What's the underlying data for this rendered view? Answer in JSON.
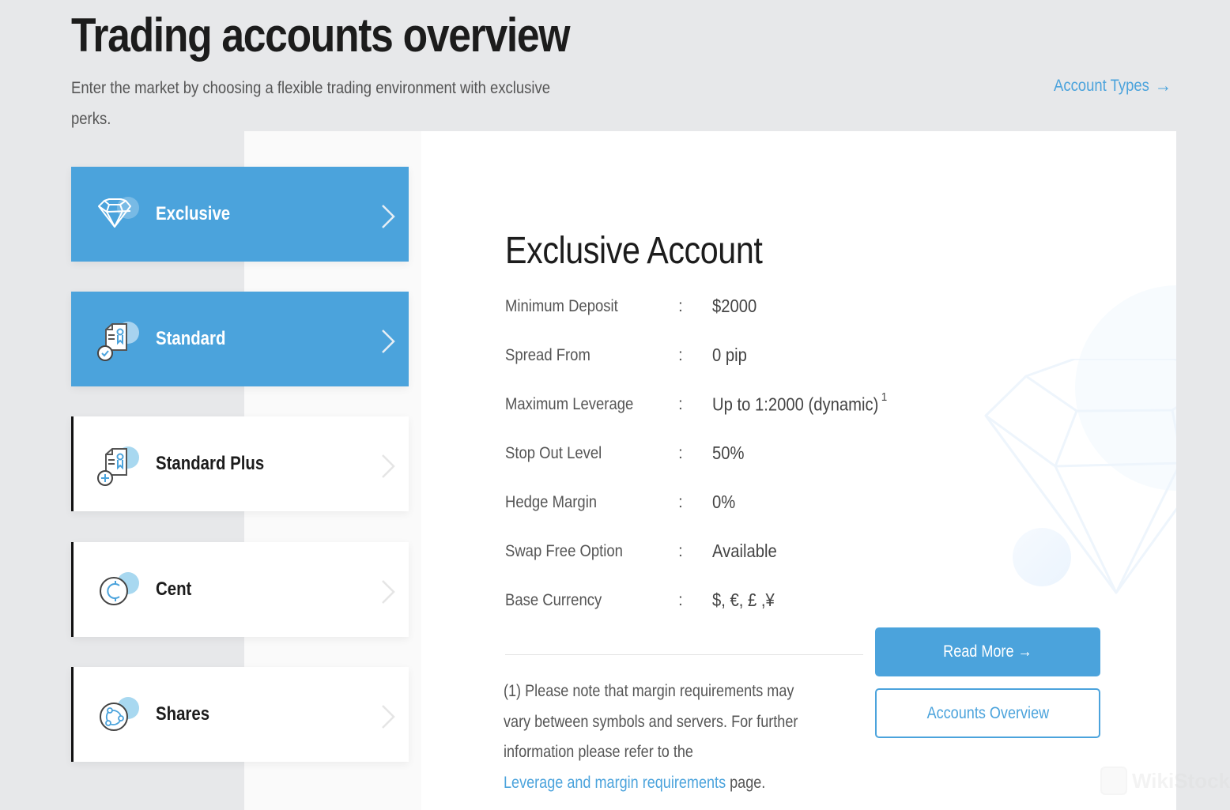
{
  "header": {
    "title": "Trading accounts overview",
    "subtitle": "Enter the market by choosing a flexible trading environment with exclusive perks.",
    "account_types_link": "Account Types",
    "account_types_arrow": "→"
  },
  "tabs": [
    {
      "label": "Exclusive",
      "icon": "diamond-icon",
      "active": true
    },
    {
      "label": "Standard",
      "icon": "certificate-check-icon",
      "active": true
    },
    {
      "label": "Standard Plus",
      "icon": "certificate-plus-icon",
      "active": false
    },
    {
      "label": "Cent",
      "icon": "cent-coin-icon",
      "active": false
    },
    {
      "label": "Shares",
      "icon": "shares-network-icon",
      "active": false
    }
  ],
  "account": {
    "title": "Exclusive Account",
    "specs": [
      {
        "label": "Minimum Deposit",
        "value": " $2000"
      },
      {
        "label": "Spread From",
        "value": "0 pip"
      },
      {
        "label": "Maximum Leverage",
        "value": "Up to 1:2000 (dynamic)",
        "footnote_ref": "1"
      },
      {
        "label": "Stop Out Level",
        "value": "50%"
      },
      {
        "label": "Hedge Margin",
        "value": "0%"
      },
      {
        "label": "Swap Free Option",
        "value": "Available"
      },
      {
        "label": "Base Currency",
        "value": "$, €, £ ,¥"
      }
    ],
    "separator": ":",
    "footnote_text": "(1) Please note that margin requirements may vary between symbols and servers. For further information please refer to the",
    "footnote_link": "Leverage and margin requirements",
    "footnote_tail": " page.",
    "read_more_label": "Read More →",
    "accounts_overview_label": "Accounts Overview"
  },
  "colors": {
    "accent": "#4ba3dc",
    "background": "#e7e8ea",
    "title_text": "#1c1c1c"
  },
  "watermark": "WikiStock"
}
